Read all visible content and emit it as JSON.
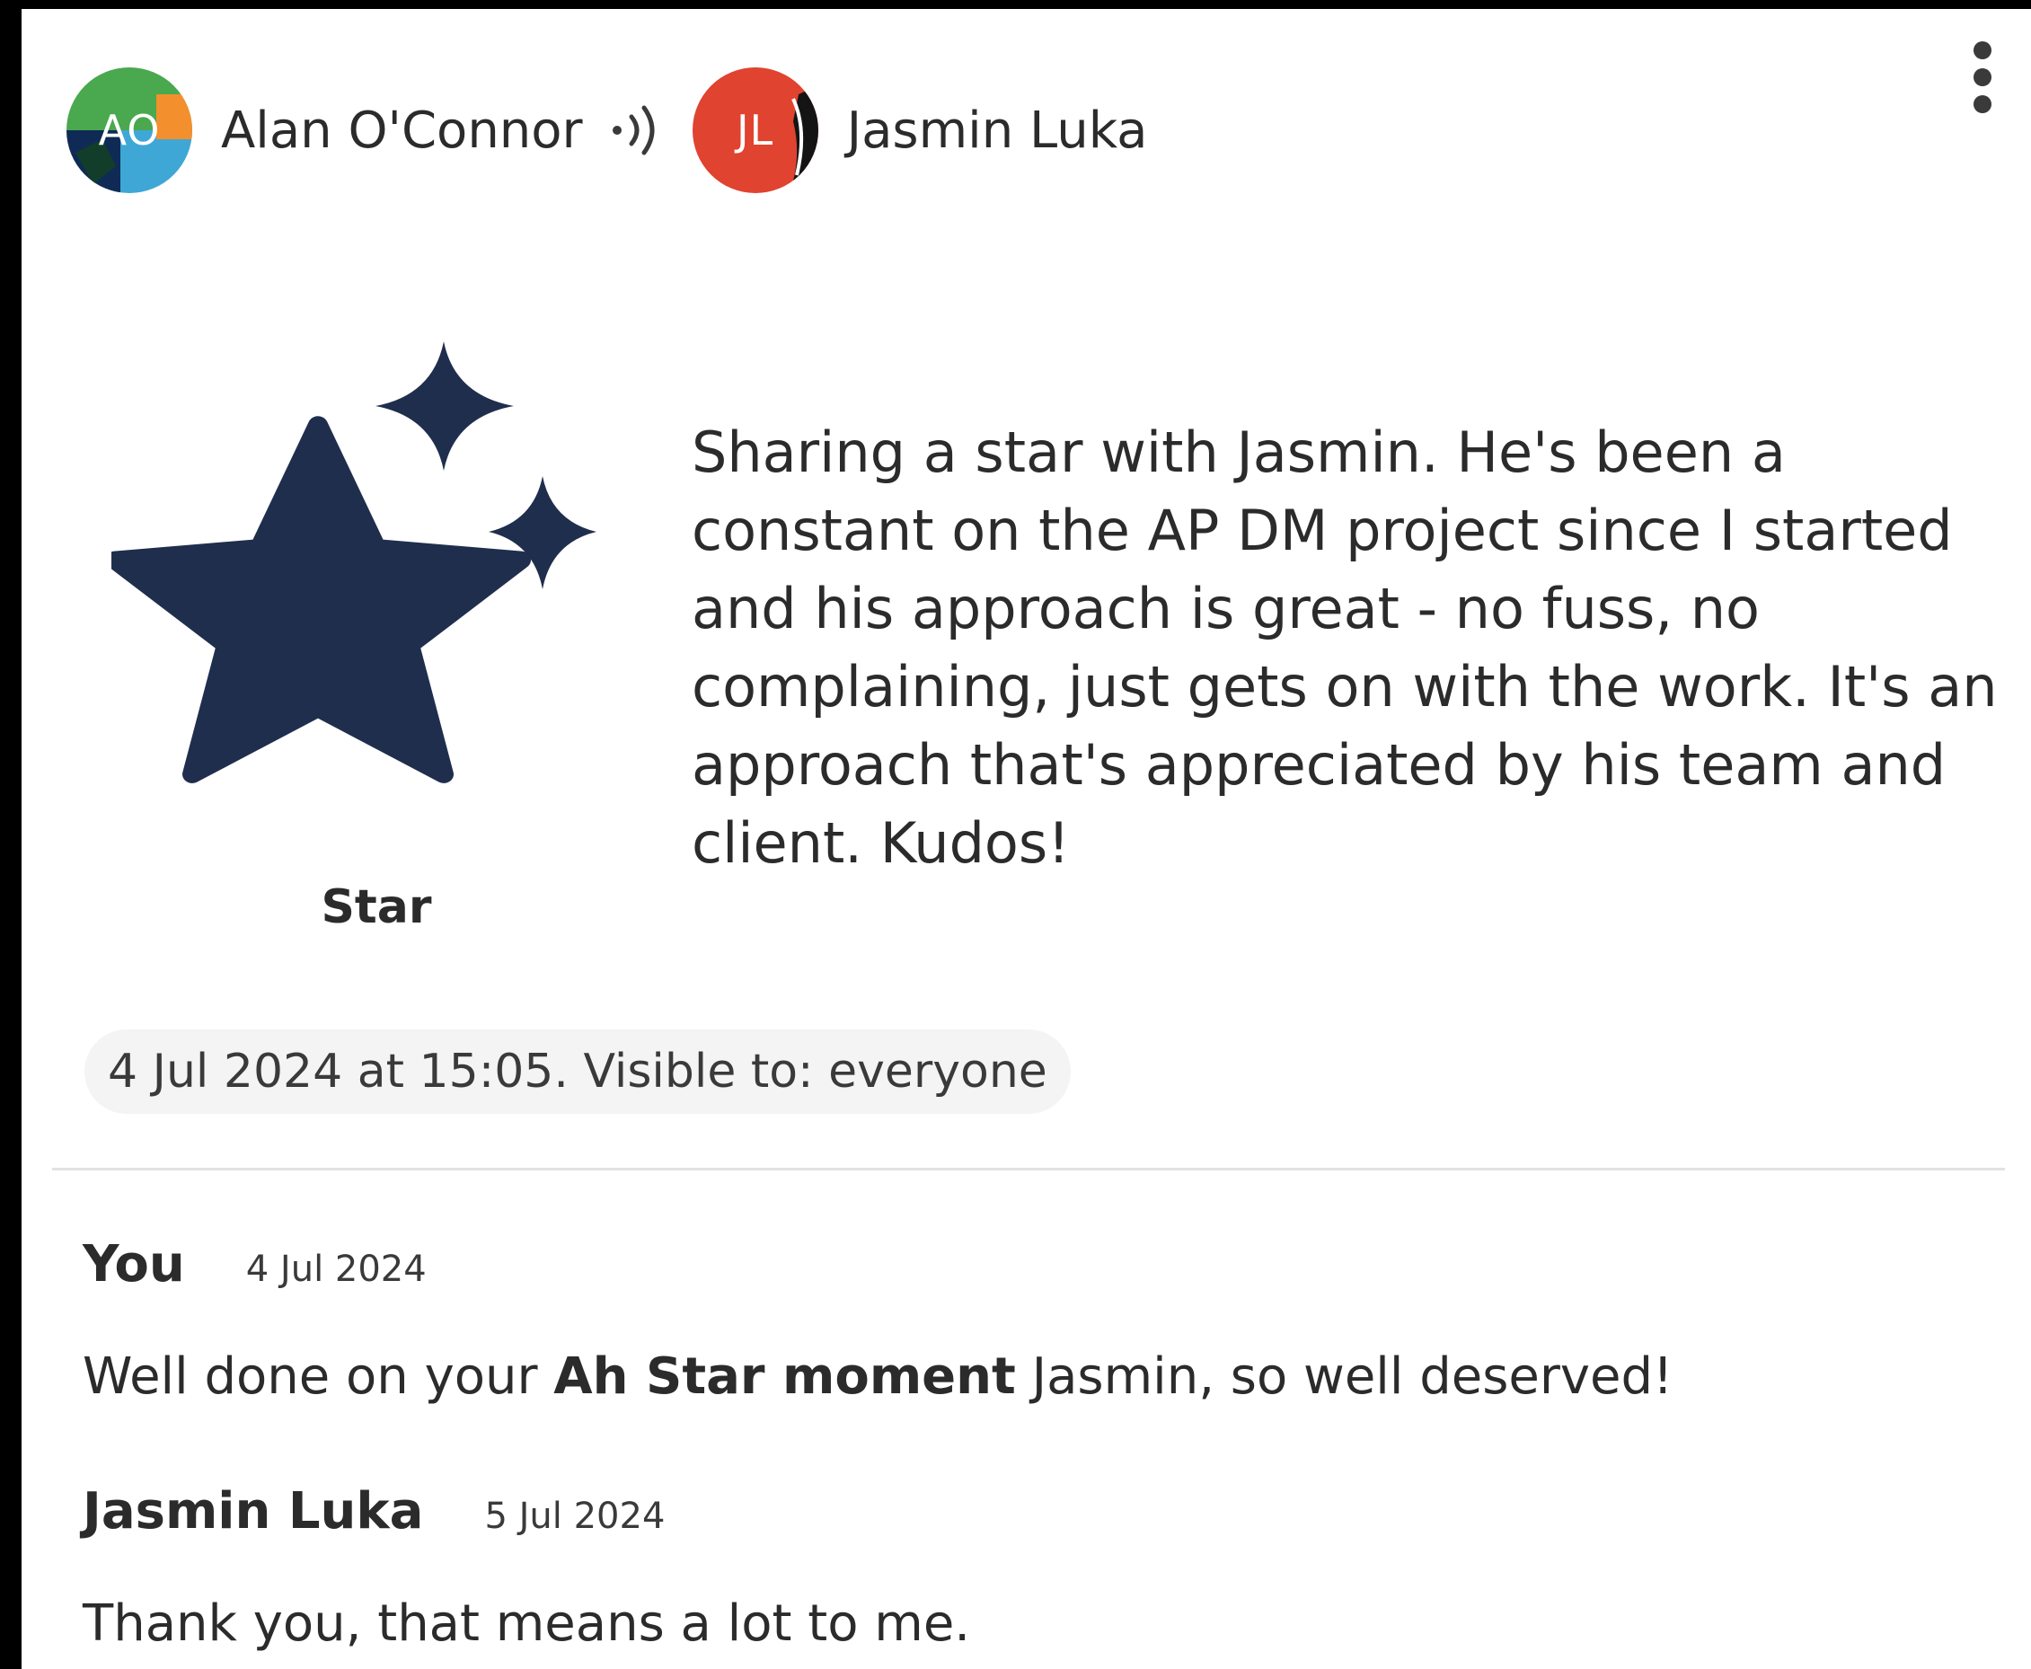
{
  "post": {
    "sender": {
      "name": "Alan O'Connor",
      "initials": "AO"
    },
    "recipient": {
      "name": "Jasmin Luka",
      "initials": "JL"
    },
    "badge_label": "Star",
    "message": "Sharing a star with Jasmin. He's been a constant on the AP DM project since I started and his approach is great - no fuss, no complaining, just gets on with the work. It's an approach that's appreciated by his team and client. Kudos!",
    "meta": "4 Jul 2024 at 15:05. Visible to: everyone"
  },
  "comments": [
    {
      "author": "You",
      "date": "4 Jul 2024",
      "text_before": "Well done on your ",
      "text_bold": "Ah Star moment",
      "text_after": " Jasmin, so well deserved!"
    },
    {
      "author": "Jasmin Luka",
      "date": "5 Jul 2024",
      "text": "Thank you, that means a lot to me."
    }
  ],
  "icons": {
    "menu": "more-vertical-icon",
    "flow": "sound-waves-icon",
    "badge": "star-sparkles-icon"
  },
  "colors": {
    "star": "#1f2e4d",
    "recipient_avatar": "#e0432f",
    "divider": "#e2e2e2",
    "meta_background": "#f4f4f4"
  }
}
